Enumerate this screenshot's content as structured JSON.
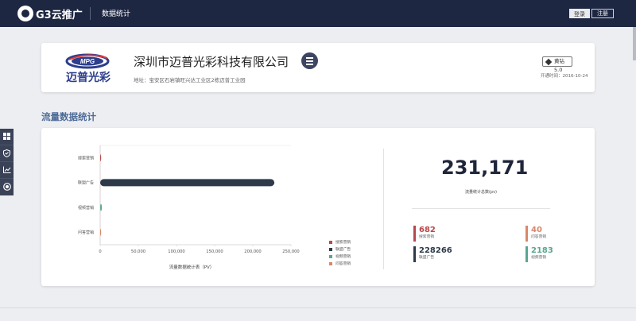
{
  "nav": {
    "brand": "G3云推广",
    "page_title": "数据统计",
    "login_label": "登录",
    "register_label": "注册"
  },
  "company": {
    "name": "深圳市迈普光彩科技有限公司",
    "logo_text": "迈普光彩",
    "logo_mark": "MPG",
    "address": "地址：宝安区石岩镇旺兴达工业区2栋迈普工业园",
    "member_label": "黄钻5.0",
    "open_time": "开通时间：2016-10-24"
  },
  "section": {
    "title": "流量数据统计"
  },
  "chart_data": {
    "type": "bar",
    "orientation": "horizontal",
    "categories": [
      "搜索营销",
      "联盟广告",
      "视频营销",
      "问答营销"
    ],
    "values": [
      682,
      228266,
      2183,
      40
    ],
    "colors": [
      "#b8484a",
      "#2d3a4a",
      "#5aa690",
      "#d9876a"
    ],
    "xlabel": "流量数据统计表（PV）",
    "xlim": [
      0,
      250000
    ],
    "xticks": [
      "0",
      "50,000",
      "100,000",
      "150,000",
      "200,000",
      "250,000"
    ],
    "legend": [
      "搜索营销",
      "联盟广告",
      "视频营销",
      "问答营销"
    ],
    "legend_position": "bottom-right",
    "grid": false
  },
  "summary": {
    "total_value": "231,171",
    "total_label": "流量统计总数(pv)",
    "metrics": [
      {
        "value": "682",
        "label": "搜索营销",
        "color": "#b8484a"
      },
      {
        "value": "40",
        "label": "问答营销",
        "color": "#d9876a"
      },
      {
        "value": "228266",
        "label": "联盟广告",
        "color": "#2d3a4a"
      },
      {
        "value": "2183",
        "label": "视频营销",
        "color": "#5aa690"
      }
    ]
  },
  "side_toolbar": {
    "icons": [
      "grid-icon",
      "shield-icon",
      "chart-icon",
      "target-icon"
    ]
  }
}
